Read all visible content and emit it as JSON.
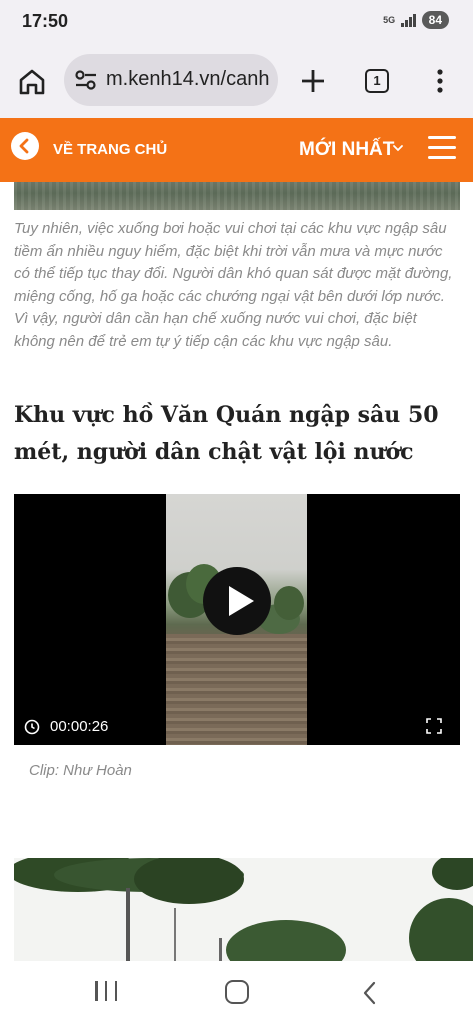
{
  "status_bar": {
    "time": "17:50",
    "network": "5G",
    "battery": "84",
    "icons": [
      "5g-icon",
      "signal-icon",
      "battery-icon"
    ]
  },
  "browser": {
    "url": "m.kenh14.vn/canh",
    "tab_count": "1",
    "icons": [
      "home-icon",
      "site-settings-icon",
      "new-tab-plus-icon",
      "tab-switcher-icon",
      "overflow-menu-icon"
    ]
  },
  "site_header": {
    "back_label": "VỀ TRANG CHỦ",
    "latest_label": "MỚI NHẤT",
    "accent_color": "#f47216"
  },
  "article": {
    "paragraph": "Tuy nhiên, việc xuống bơi hoặc vui chơi tại các khu vực ngập sâu tiềm ẩn nhiều nguy hiểm, đặc biệt khi trời vẫn mưa và mực nước có thể tiếp tục thay đổi. Người dân khó quan sát được mặt đường, miệng cống, hố ga hoặc các chướng ngại vật bên dưới lớp nước. Vì vậy, người dân cần hạn chế xuống nước vui chơi, đặc biệt không nên để trẻ em tự ý tiếp cận các khu vực ngập sâu.",
    "heading": "Khu vực hồ Văn Quán ngập sâu 50 mét, người dân chật vật lội nước",
    "video": {
      "duration": "00:00:26",
      "icons": [
        "play-icon",
        "clock-icon",
        "fullscreen-icon"
      ]
    },
    "caption": "Clip: Như Hoàn"
  },
  "nav_bar": {
    "icons": [
      "recent-apps-icon",
      "home-icon",
      "back-icon"
    ]
  }
}
